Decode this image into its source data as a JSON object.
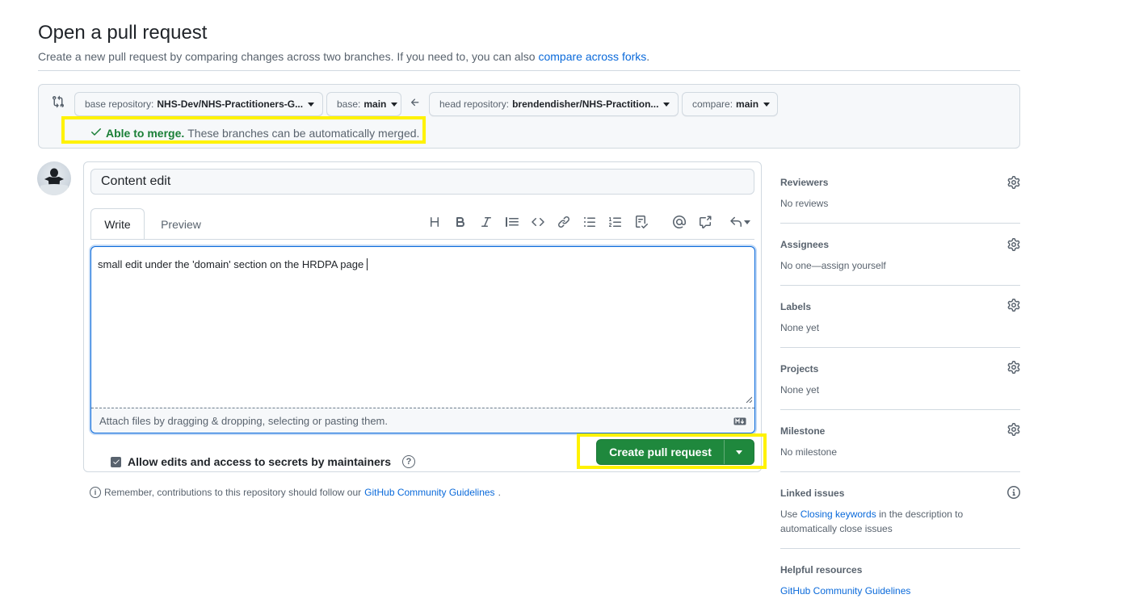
{
  "header": {
    "title": "Open a pull request",
    "subtitle": "Create a new pull request by comparing changes across two branches. If you need to, you can also",
    "subtitle_link": "compare across forks",
    "subtitle_end": "."
  },
  "compare": {
    "base_repo_label": "base repository:",
    "base_repo_value": "NHS-Dev/NHS-Practitioners-G...",
    "base_label": "base:",
    "base_value": "main",
    "head_repo_label": "head repository:",
    "head_repo_value": "brendendisher/NHS-Practition...",
    "compare_label": "compare:",
    "compare_value": "main",
    "merge_ok": "Able to merge.",
    "merge_text": "These branches can be automatically merged."
  },
  "form": {
    "title_value": "Content edit",
    "tab_write": "Write",
    "tab_preview": "Preview",
    "body_text": "small edit under the 'domain' section on the HRDPA page",
    "attach_text": "Attach files by dragging & dropping, selecting or pasting them.",
    "allow_edits_label": "Allow edits and access to secrets by maintainers",
    "allow_edits_checked": true,
    "submit_label": "Create pull request",
    "help_glyph": "?",
    "info_glyph": "i"
  },
  "footer": {
    "remember_text": "Remember, contributions to this repository should follow our",
    "remember_link": "GitHub Community Guidelines",
    "remember_end": "."
  },
  "sidebar": {
    "reviewers": {
      "title": "Reviewers",
      "value": "No reviews"
    },
    "assignees": {
      "title": "Assignees",
      "value": "No one—assign yourself"
    },
    "labels": {
      "title": "Labels",
      "value": "None yet"
    },
    "projects": {
      "title": "Projects",
      "value": "None yet"
    },
    "milestone": {
      "title": "Milestone",
      "value": "No milestone"
    },
    "linked_issues": {
      "title": "Linked issues",
      "text_before": "Use",
      "link": "Closing keywords",
      "text_after": "in the description to automatically close issues"
    },
    "helpful": {
      "title": "Helpful resources",
      "link": "GitHub Community Guidelines"
    }
  },
  "colors": {
    "accent": "#0969da",
    "success": "#1f883d",
    "merge_ok": "#1a7f37",
    "highlight": "#fff200"
  }
}
